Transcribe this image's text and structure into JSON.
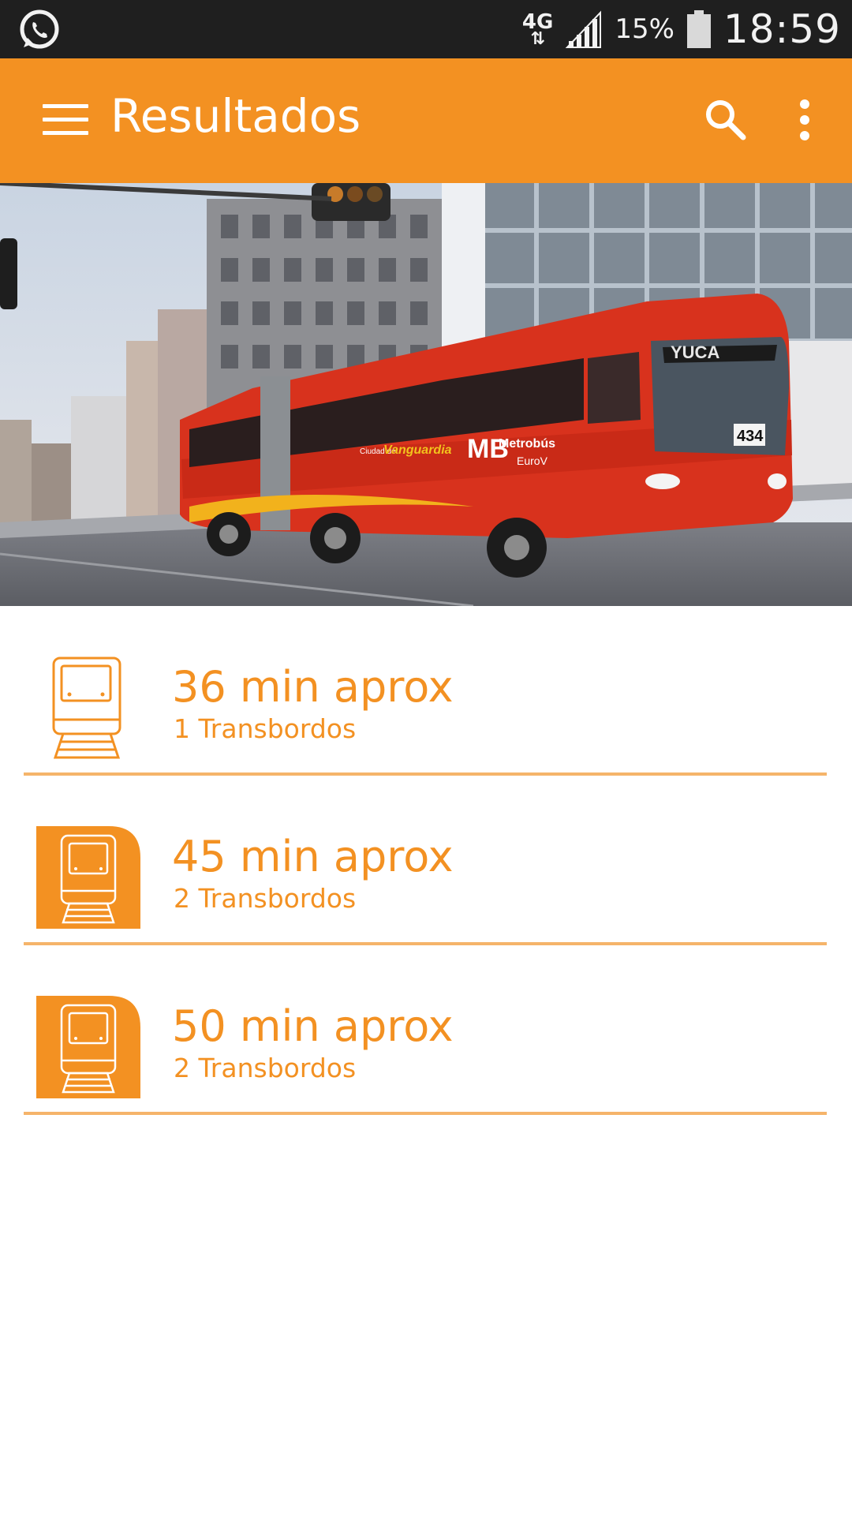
{
  "status_bar": {
    "app_icon": "whatsapp-icon",
    "network": "4G",
    "network_arrows": "⇅",
    "signal_icon": "signal-icon",
    "battery_percent": "15%",
    "battery_icon": "battery-icon",
    "time": "18:59"
  },
  "app_bar": {
    "title": "Resultados",
    "menu_icon": "hamburger-menu-icon",
    "search_icon": "search-icon",
    "overflow_icon": "more-vert-icon"
  },
  "hero": {
    "image": "metrobus-photo",
    "bus_route_sign": "YUCA",
    "bus_number": "434",
    "bus_brand": "Metrobús",
    "bus_model": "EuroV",
    "bus_slogan_prefix": "Ciudad de",
    "bus_slogan": "Vanguardia"
  },
  "colors": {
    "accent": "#f39122",
    "divider": "#f5b46a",
    "status_bar": "#1f1f1f"
  },
  "results": [
    {
      "duration": "36 min aprox",
      "transfers": "1 Transbordos",
      "icon": "train-icon-outline"
    },
    {
      "duration": "45 min aprox",
      "transfers": "2 Transbordos",
      "icon": "train-icon-filled"
    },
    {
      "duration": "50 min aprox",
      "transfers": "2 Transbordos",
      "icon": "train-icon-filled"
    }
  ]
}
